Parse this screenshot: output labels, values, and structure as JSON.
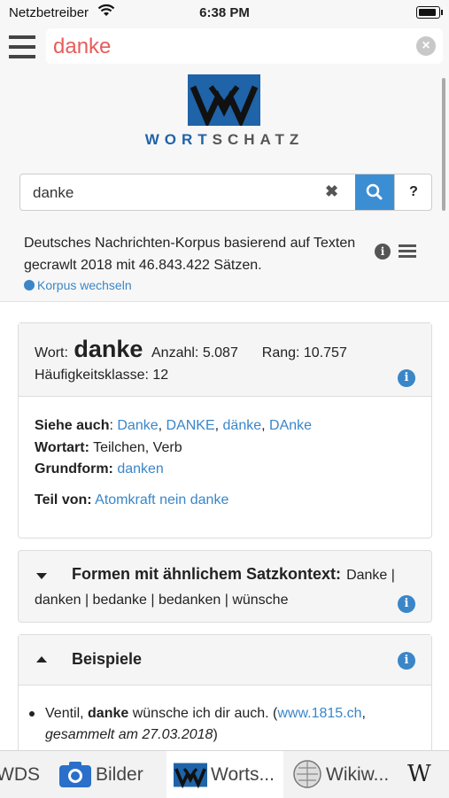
{
  "status": {
    "carrier": "Netzbetreiber",
    "time": "6:38 PM"
  },
  "search": {
    "query": "danke"
  },
  "wortschatz": {
    "logo_word": [
      "WORT",
      "SCHATZ"
    ],
    "search_value": "danke",
    "help_label": "?",
    "corpus_description": "Deutsches Nachrichten-Korpus basierend auf Texten gecrawlt 2018 mit 46.843.422 Sätzen.",
    "switch_corpus": "Korpus wechseln"
  },
  "word_card": {
    "wort_label": "Wort:",
    "word": "danke",
    "anzahl": "Anzahl: 5.087",
    "rang": "Rang: 10.757",
    "klasse": "Häufigkeitsklasse: 12",
    "siehe_label": "Siehe auch",
    "siehe_links": [
      "Danke",
      "DANKE",
      "dänke",
      "DAnke"
    ],
    "wortart_label": "Wortart:",
    "wortart_value": "Teilchen, Verb",
    "grundform_label": "Grundform:",
    "grundform_link": "danken",
    "teil_label": "Teil von:",
    "teil_link": "Atomkraft nein danke"
  },
  "similar_card": {
    "title": "Formen mit ähnlichem Satzkontext:",
    "forms_line1": "Danke |",
    "forms_line2": "danken | bedanke | bedanken | wünsche"
  },
  "examples_card": {
    "title": "Beispiele",
    "example_pre": "Ventil, ",
    "example_bold": "danke",
    "example_post": " wünsche ich dir auch. (",
    "example_link": "www.1815.ch",
    "example_tail": ",",
    "example_date": "gesammelt am 27.03.2018",
    "example_close": ")"
  },
  "tabs": [
    {
      "label": "WDS"
    },
    {
      "label": "Bilder"
    },
    {
      "label": "Worts..."
    },
    {
      "label": "Wikiw..."
    },
    {
      "label": "W"
    }
  ],
  "colors": {
    "accent": "#3a86c8",
    "query": "#e85c5c",
    "logo_blue": "#1f63a8"
  }
}
